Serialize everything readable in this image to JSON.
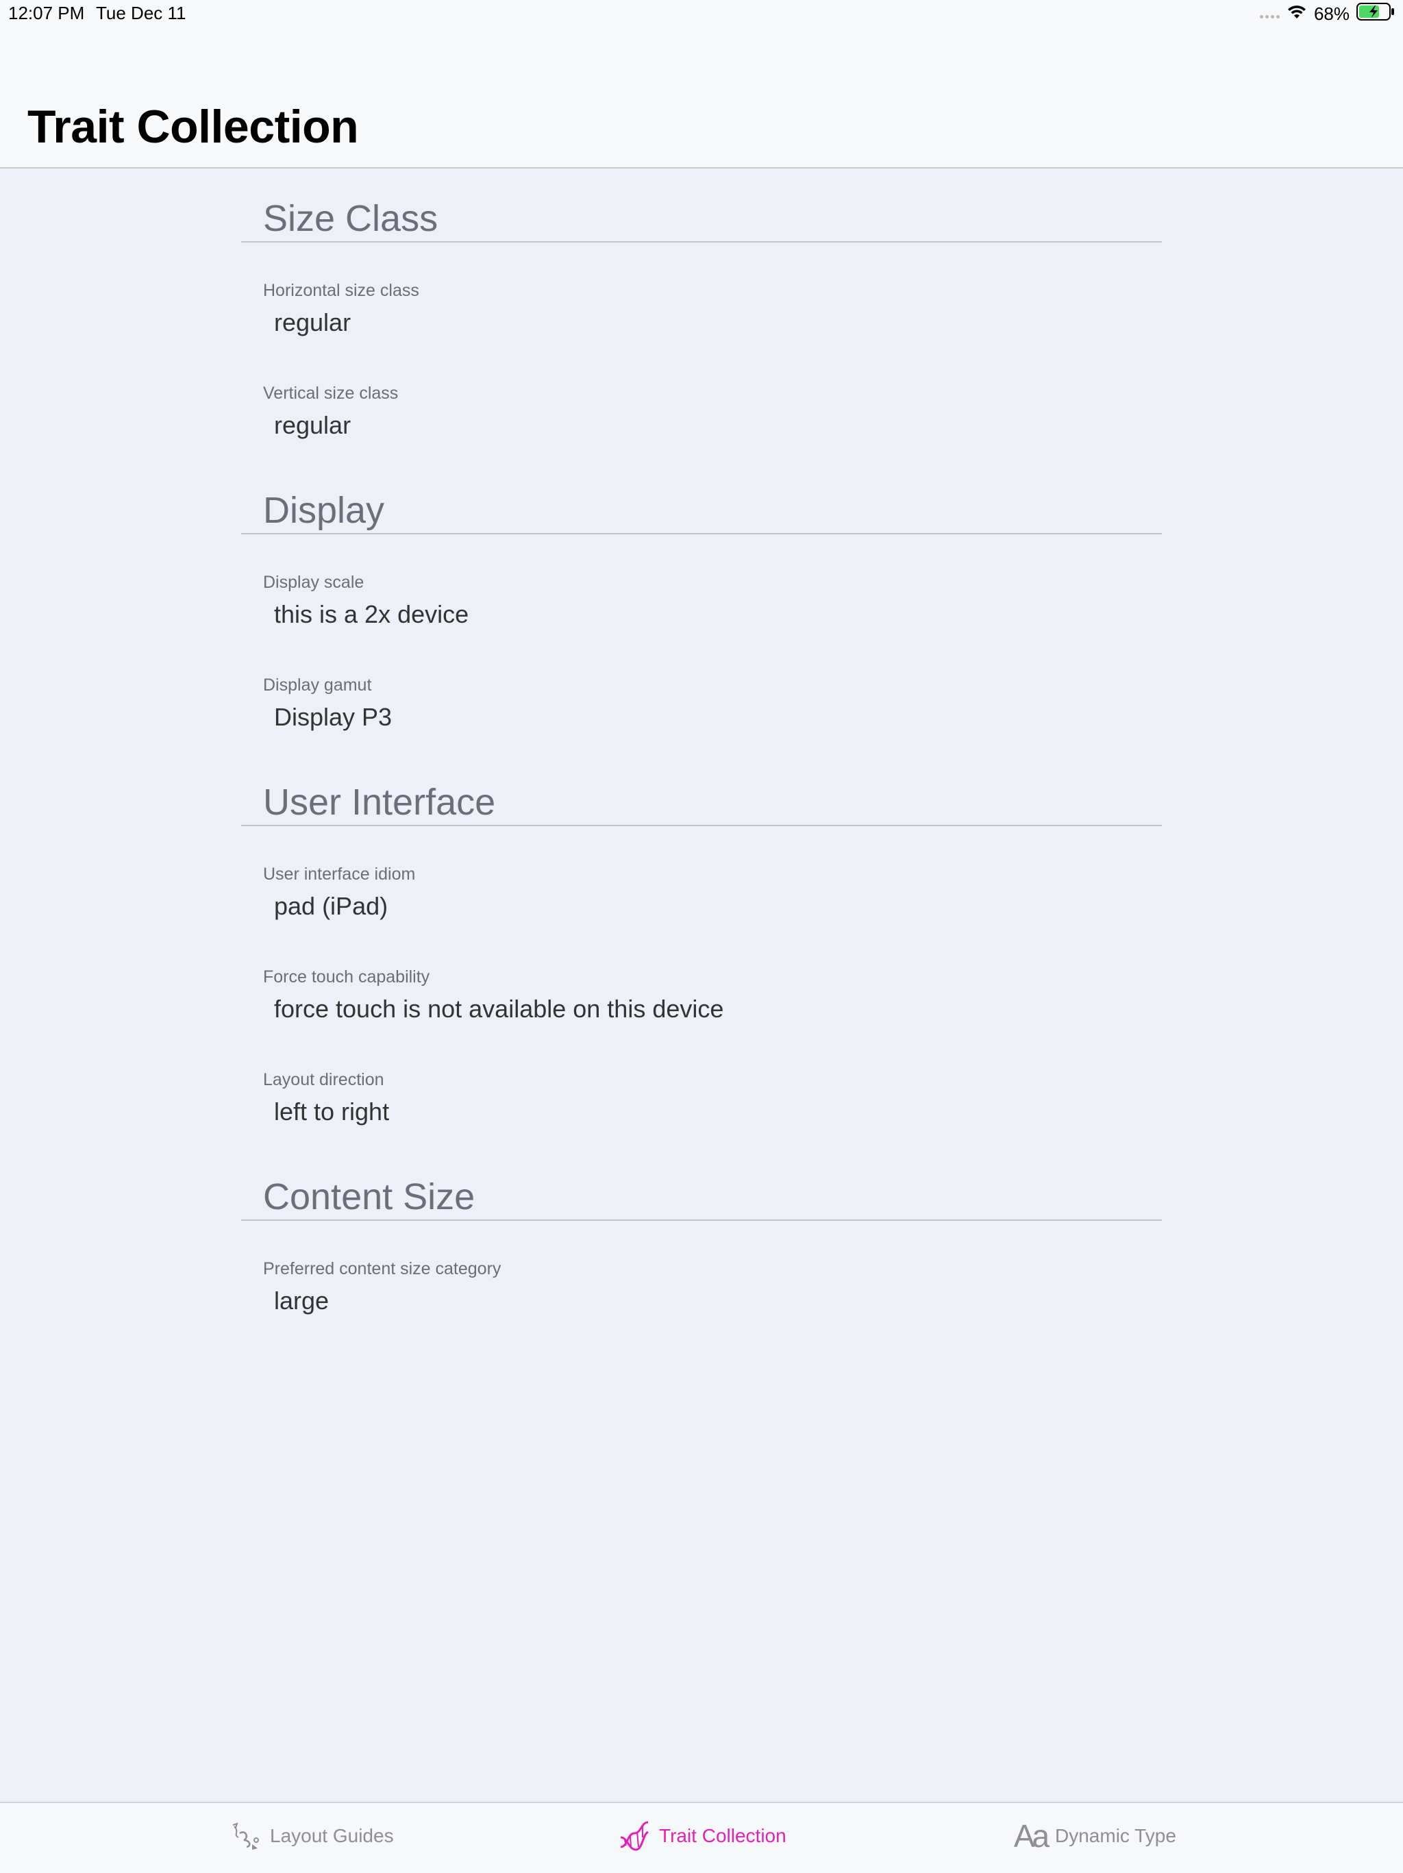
{
  "status_bar": {
    "time": "12:07 PM",
    "date": "Tue Dec 11",
    "battery_percent": "68%",
    "battery_level": 0.68
  },
  "nav": {
    "title": "Trait Collection"
  },
  "sections": [
    {
      "title": "Size Class",
      "rows": [
        {
          "label": "Horizontal size class",
          "value": "regular"
        },
        {
          "label": "Vertical size class",
          "value": "regular"
        }
      ]
    },
    {
      "title": "Display",
      "rows": [
        {
          "label": "Display scale",
          "value": "this is a 2x device"
        },
        {
          "label": "Display gamut",
          "value": "Display P3"
        }
      ]
    },
    {
      "title": "User Interface",
      "rows": [
        {
          "label": "User interface idiom",
          "value": "pad (iPad)"
        },
        {
          "label": "Force touch capability",
          "value": "force touch is not available on this device"
        },
        {
          "label": "Layout direction",
          "value": "left to right"
        }
      ]
    },
    {
      "title": "Content Size",
      "rows": [
        {
          "label": "Preferred content size category",
          "value": "large"
        }
      ]
    }
  ],
  "tab_bar": {
    "tabs": [
      {
        "label": "Layout Guides",
        "icon": "layout-guides-icon",
        "active": false
      },
      {
        "label": "Trait Collection",
        "icon": "dna-icon",
        "active": true
      },
      {
        "label": "Dynamic Type",
        "icon": "aa-icon",
        "icon_glyph": "Aa",
        "active": false
      }
    ]
  },
  "colors": {
    "accent": "#e222b4",
    "background": "#edf0f7",
    "section_title": "#6b6f7a",
    "tab_inactive": "#8e8e93"
  }
}
